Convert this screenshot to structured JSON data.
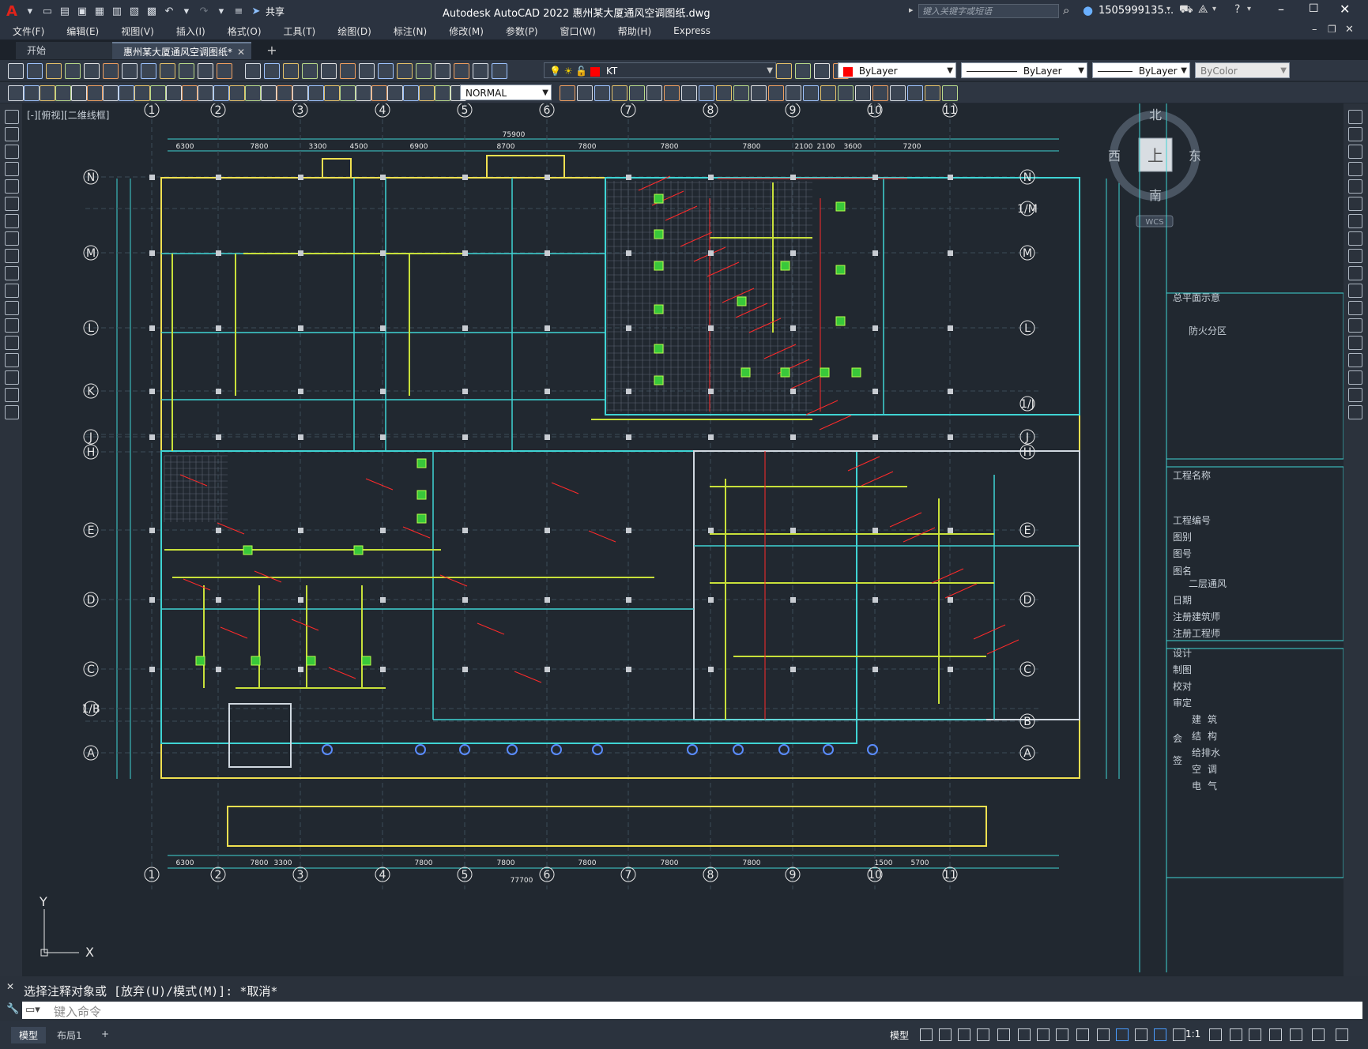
{
  "window": {
    "title": "Autodesk AutoCAD 2022    惠州某大厦通风空调图纸.dwg",
    "share": "共享",
    "search_placeholder": "键入关键字或短语",
    "user": "1505999135..."
  },
  "menu": [
    "文件(F)",
    "编辑(E)",
    "视图(V)",
    "插入(I)",
    "格式(O)",
    "工具(T)",
    "绘图(D)",
    "标注(N)",
    "修改(M)",
    "参数(P)",
    "窗口(W)",
    "帮助(H)",
    "Express"
  ],
  "tabs": {
    "start": "开始",
    "doc": "惠州某大厦通风空调图纸*"
  },
  "toolbar": {
    "layer": "KT",
    "color": "ByLayer",
    "linetype": "ByLayer",
    "lineweight": "ByLayer",
    "plotstyle": "ByColor",
    "dimstyle": "NORMAL"
  },
  "viewport_label": "[-][俯视][二维线框]",
  "compass": {
    "n": "北",
    "s": "南",
    "e": "东",
    "w": "西",
    "top": "上",
    "wcs": "WCS"
  },
  "grid_cols": [
    "1",
    "2",
    "3",
    "4",
    "5",
    "6",
    "7",
    "8",
    "9",
    "10",
    "11"
  ],
  "grid_rows": [
    "N",
    "1/M",
    "M",
    "L",
    "K",
    "1/J",
    "J",
    "H",
    "E",
    "D",
    "C",
    "1/B",
    "B",
    "A"
  ],
  "dims_top": [
    "6300",
    "7800",
    "3300",
    "4500",
    "6900",
    "8700",
    "7800",
    "7800",
    "7800",
    "2100",
    "2100",
    "3600",
    "7200"
  ],
  "dims_total_top": "75900",
  "dims_bottom": [
    "6300",
    "7800",
    "3300",
    "7800",
    "7800",
    "7800",
    "7800",
    "7800",
    "1500",
    "5700"
  ],
  "dims_total_bottom": "77700",
  "title_block": [
    "总平面示意",
    "防火分区",
    "工程名称",
    "工程编号",
    "图别",
    "图号",
    "图名",
    "二层通风",
    "日期",
    "注册建筑师",
    "注册工程师",
    "设计",
    "制图",
    "校对",
    "审定",
    "建",
    "筑",
    "结",
    "构",
    "给排水",
    "空",
    "调",
    "电",
    "气",
    "会",
    "签"
  ],
  "command_history": "选择注释对象或 [放弃(U)/模式(M)]: *取消*",
  "command_placeholder": "键入命令",
  "layout_tabs": {
    "model": "模型",
    "layout1": "布局1"
  },
  "status": {
    "model": "模型",
    "scale": "1:1"
  },
  "ucs": {
    "x": "X",
    "y": "Y"
  }
}
